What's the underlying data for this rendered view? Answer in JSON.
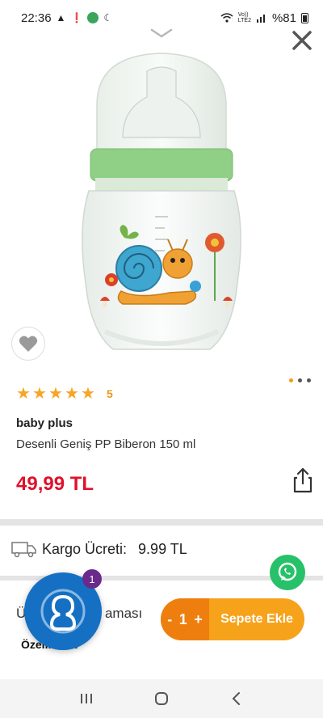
{
  "status_bar": {
    "time": "22:36",
    "network_label": "Vo))\nLTE2",
    "battery": "%81",
    "icons": [
      "gallery-icon",
      "notification-icon",
      "app-icon",
      "moon-icon",
      "wifi-icon",
      "signal-icon",
      "battery-icon"
    ]
  },
  "product": {
    "rating_stars": 5,
    "rating_count": "5",
    "brand": "baby plus",
    "name": "Desenli Geniş PP Biberon 150 ml",
    "price": "49,99 TL",
    "image_page_count": 3,
    "image_active_index": 0
  },
  "shipping": {
    "label": "Kargo Ücreti:",
    "value": "9.99 TL"
  },
  "description": {
    "section_title_start": "Ür",
    "section_title_end": "aması",
    "features_label": "Özellikleri:"
  },
  "chat": {
    "badge_count": "1"
  },
  "cart": {
    "minus": "-",
    "quantity": "1",
    "plus": "+",
    "add_label": "Sepete Ekle"
  },
  "colors": {
    "price": "#e0112b",
    "accent": "#f7a21b",
    "accent_dark": "#ee7f0e",
    "star": "#f5a623",
    "whatsapp": "#27c16a",
    "chat": "#1570c4"
  }
}
